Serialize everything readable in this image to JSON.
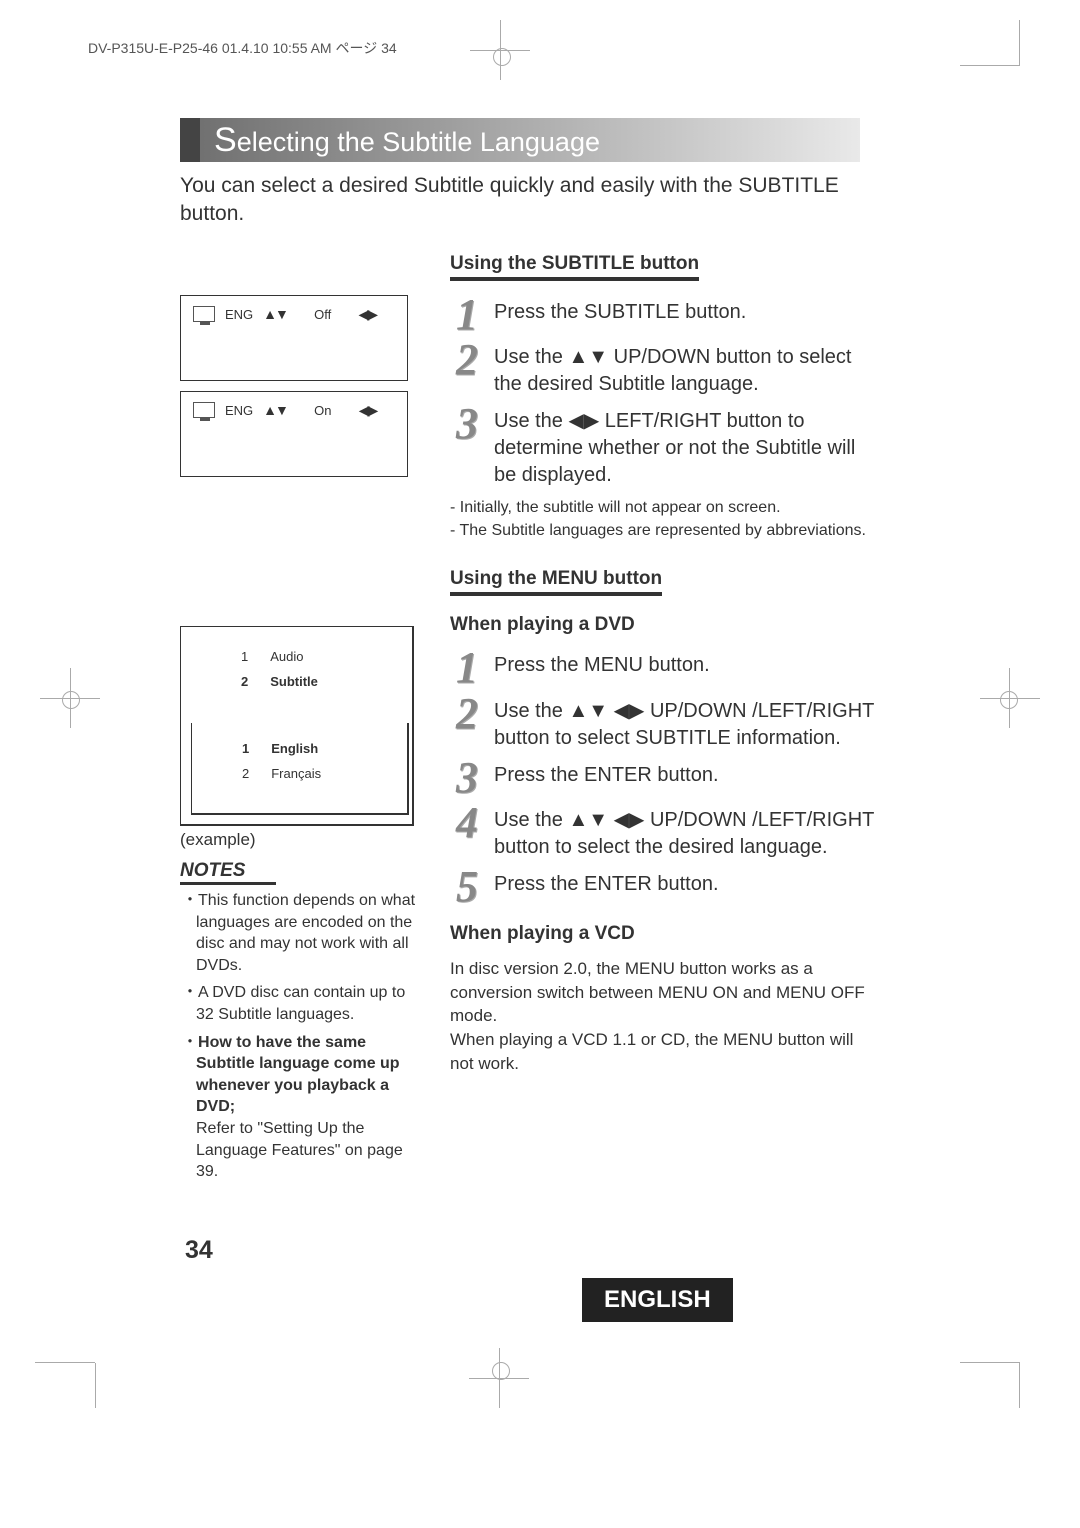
{
  "printHeader": "DV-P315U-E-P25-46  01.4.10 10:55 AM  ページ 34",
  "title": "Selecting the Subtitle Language",
  "intro": "You can select a desired Subtitle quickly and easily with the SUBTITLE button.",
  "section1": {
    "heading": "Using the SUBTITLE button",
    "osd": [
      {
        "lang": "ENG",
        "state": "Off"
      },
      {
        "lang": "ENG",
        "state": "On"
      }
    ],
    "steps": [
      "Press the SUBTITLE button.",
      "Use the ▲▼ UP/DOWN button to select the desired Subtitle language.",
      "Use the ◀▶ LEFT/RIGHT button to determine whether or not the Subtitle will be displayed."
    ],
    "notes": [
      "- Initially, the subtitle will not appear on screen.",
      "- The Subtitle languages are represented by abbreviations."
    ]
  },
  "section2": {
    "heading": "Using the MENU button",
    "subA": "When playing a DVD",
    "menu1": [
      {
        "n": "1",
        "label": "Audio",
        "bold": false
      },
      {
        "n": "2",
        "label": "Subtitle",
        "bold": true
      }
    ],
    "menu2": [
      {
        "n": "1",
        "label": "English",
        "bold": true
      },
      {
        "n": "2",
        "label": "Français",
        "bold": false
      }
    ],
    "example": "(example)",
    "notesHeading": "NOTES",
    "sideNotes": [
      "This function depends on what languages are encoded on the disc and may not work with all DVDs.",
      "A DVD disc can contain up to 32 Subtitle languages."
    ],
    "sideNoteBold": "How to have the same Subtitle language come up whenever you playback a DVD;",
    "sideNoteTail": "Refer to \"Setting Up the Language Features\" on page 39.",
    "steps": [
      "Press the MENU button.",
      "Use the ▲▼ ◀▶ UP/DOWN /LEFT/RIGHT button to select SUBTITLE information.",
      "Press the ENTER button.",
      "Use the ▲▼ ◀▶ UP/DOWN /LEFT/RIGHT button to select the desired language.",
      "Press the ENTER button."
    ],
    "subB": "When playing a VCD",
    "vcdText": "In disc version 2.0, the MENU button works as a conversion switch between MENU ON and MENU OFF mode.\nWhen playing a VCD 1.1 or CD, the MENU button will not work."
  },
  "pageNumber": "34",
  "langTab": "ENGLISH"
}
